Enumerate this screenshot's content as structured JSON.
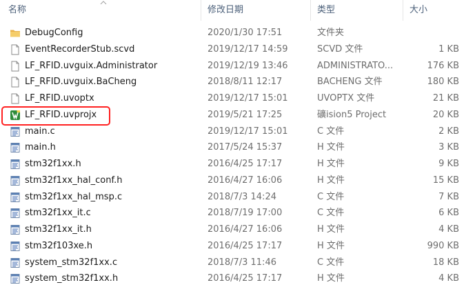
{
  "columns": {
    "name": "名称",
    "date": "修改日期",
    "type": "类型",
    "size": "大小"
  },
  "sort_column": "name",
  "files": [
    {
      "name": "DebugConfig",
      "date": "2020/1/30 17:51",
      "type": "文件夹",
      "size": "",
      "icon": "folder-icon"
    },
    {
      "name": "EventRecorderStub.scvd",
      "date": "2019/12/17 14:59",
      "type": "SCVD 文件",
      "size": "1 KB",
      "icon": "file-icon"
    },
    {
      "name": "LF_RFID.uvguix.Administrator",
      "date": "2019/12/19 13:46",
      "type": "ADMINISTRATO...",
      "size": "176 KB",
      "icon": "file-icon"
    },
    {
      "name": "LF_RFID.uvguix.BaCheng",
      "date": "2018/8/11 12:17",
      "type": "BACHENG 文件",
      "size": "180 KB",
      "icon": "file-icon"
    },
    {
      "name": "LF_RFID.uvoptx",
      "date": "2019/12/17 15:01",
      "type": "UVOPTX 文件",
      "size": "21 KB",
      "icon": "file-icon"
    },
    {
      "name": "LF_RFID.uvprojx",
      "date": "2019/5/21 17:25",
      "type": "礦ision5 Project",
      "size": "20 KB",
      "icon": "keil-project-icon",
      "highlighted": true
    },
    {
      "name": "main.c",
      "date": "2019/12/17 15:01",
      "type": "C 文件",
      "size": "2 KB",
      "icon": "source-file-icon"
    },
    {
      "name": "main.h",
      "date": "2017/5/24 15:37",
      "type": "H 文件",
      "size": "3 KB",
      "icon": "source-file-icon"
    },
    {
      "name": "stm32f1xx.h",
      "date": "2016/4/25 17:17",
      "type": "H 文件",
      "size": "9 KB",
      "icon": "source-file-icon"
    },
    {
      "name": "stm32f1xx_hal_conf.h",
      "date": "2016/4/27 16:06",
      "type": "H 文件",
      "size": "15 KB",
      "icon": "source-file-icon"
    },
    {
      "name": "stm32f1xx_hal_msp.c",
      "date": "2018/7/3 14:24",
      "type": "C 文件",
      "size": "7 KB",
      "icon": "source-file-icon"
    },
    {
      "name": "stm32f1xx_it.c",
      "date": "2018/7/19 17:00",
      "type": "C 文件",
      "size": "6 KB",
      "icon": "source-file-icon"
    },
    {
      "name": "stm32f1xx_it.h",
      "date": "2016/4/27 16:06",
      "type": "H 文件",
      "size": "4 KB",
      "icon": "source-file-icon"
    },
    {
      "name": "stm32f103xe.h",
      "date": "2016/4/25 17:17",
      "type": "H 文件",
      "size": "990 KB",
      "icon": "source-file-icon"
    },
    {
      "name": "system_stm32f1xx.c",
      "date": "2018/7/3 11:46",
      "type": "C 文件",
      "size": "18 KB",
      "icon": "source-file-icon"
    },
    {
      "name": "system_stm32f1xx.h",
      "date": "2016/4/25 17:17",
      "type": "H 文件",
      "size": "4 KB",
      "icon": "source-file-icon"
    }
  ],
  "colors": {
    "header_text": "#4c607a",
    "highlight_border": "#ff2020",
    "folder": "#f2c15c",
    "keil_green": "#2e8b3a"
  }
}
